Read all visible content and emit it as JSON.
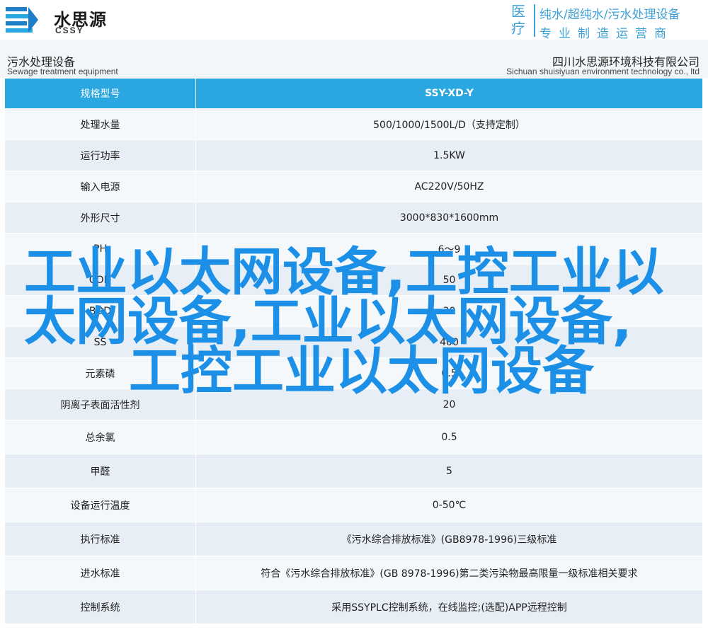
{
  "banner": {
    "brand_cn": "水思源",
    "brand_en": "CSSY",
    "med_label_1": "医",
    "med_label_2": "疗",
    "slogan_line1": "纯水/超纯水/污水处理设备",
    "slogan_line2": "专业制造运营商",
    "accent_color": "#3ea1d6"
  },
  "header": {
    "category_cn": "污水处理设备",
    "category_en": "Sewage treatment equipment",
    "company_cn": "四川水思源环境科技有限公司",
    "company_en": "Sichuan shuisiyuan environment technology co., ltd"
  },
  "table": {
    "header_label": "规格型号",
    "header_value": "SSY-XD-Y",
    "header_color": "#2aa7e1",
    "rows": [
      {
        "label": "处理水量",
        "value": "500/1000/1500L/D（支持定制）"
      },
      {
        "label": "运行功率",
        "value": "1.5KW"
      },
      {
        "label": "输入电源",
        "value": "AC220V/50HZ"
      },
      {
        "label": "外形尺寸",
        "value": "3000*830*1600mm"
      },
      {
        "label": "PH",
        "value": "6～9"
      },
      {
        "label": "COD",
        "value": "50"
      },
      {
        "label": "BOD",
        "value": "30"
      },
      {
        "label": "SS",
        "value": "400"
      },
      {
        "label": "元素磷",
        "value": "0.5"
      },
      {
        "label": "阴离子表面活性剂",
        "value": "20"
      },
      {
        "label": "总余氯",
        "value": "0.5"
      },
      {
        "label": "甲醛",
        "value": "5"
      },
      {
        "label": "设备运行温度",
        "value": "0-50℃"
      },
      {
        "label": "执行标准",
        "value": "《污水综合排放标准》(GB8978-1996)三级标准"
      },
      {
        "label": "进水标准",
        "value": "符合《污水综合排放标准》(GB 8978-1996)第二类污染物最高限量一级标准相关要求"
      },
      {
        "label": "控制系统",
        "value": "采用SSYPLC控制系统，在线监控;(选配)APP远程控制"
      }
    ]
  },
  "overlay": {
    "line1": "工业以太网设备,工控工业以",
    "line2": "太网设备,工业以太网设备,",
    "line3": "工控工业以太网设备",
    "color": "#1b90e6"
  }
}
